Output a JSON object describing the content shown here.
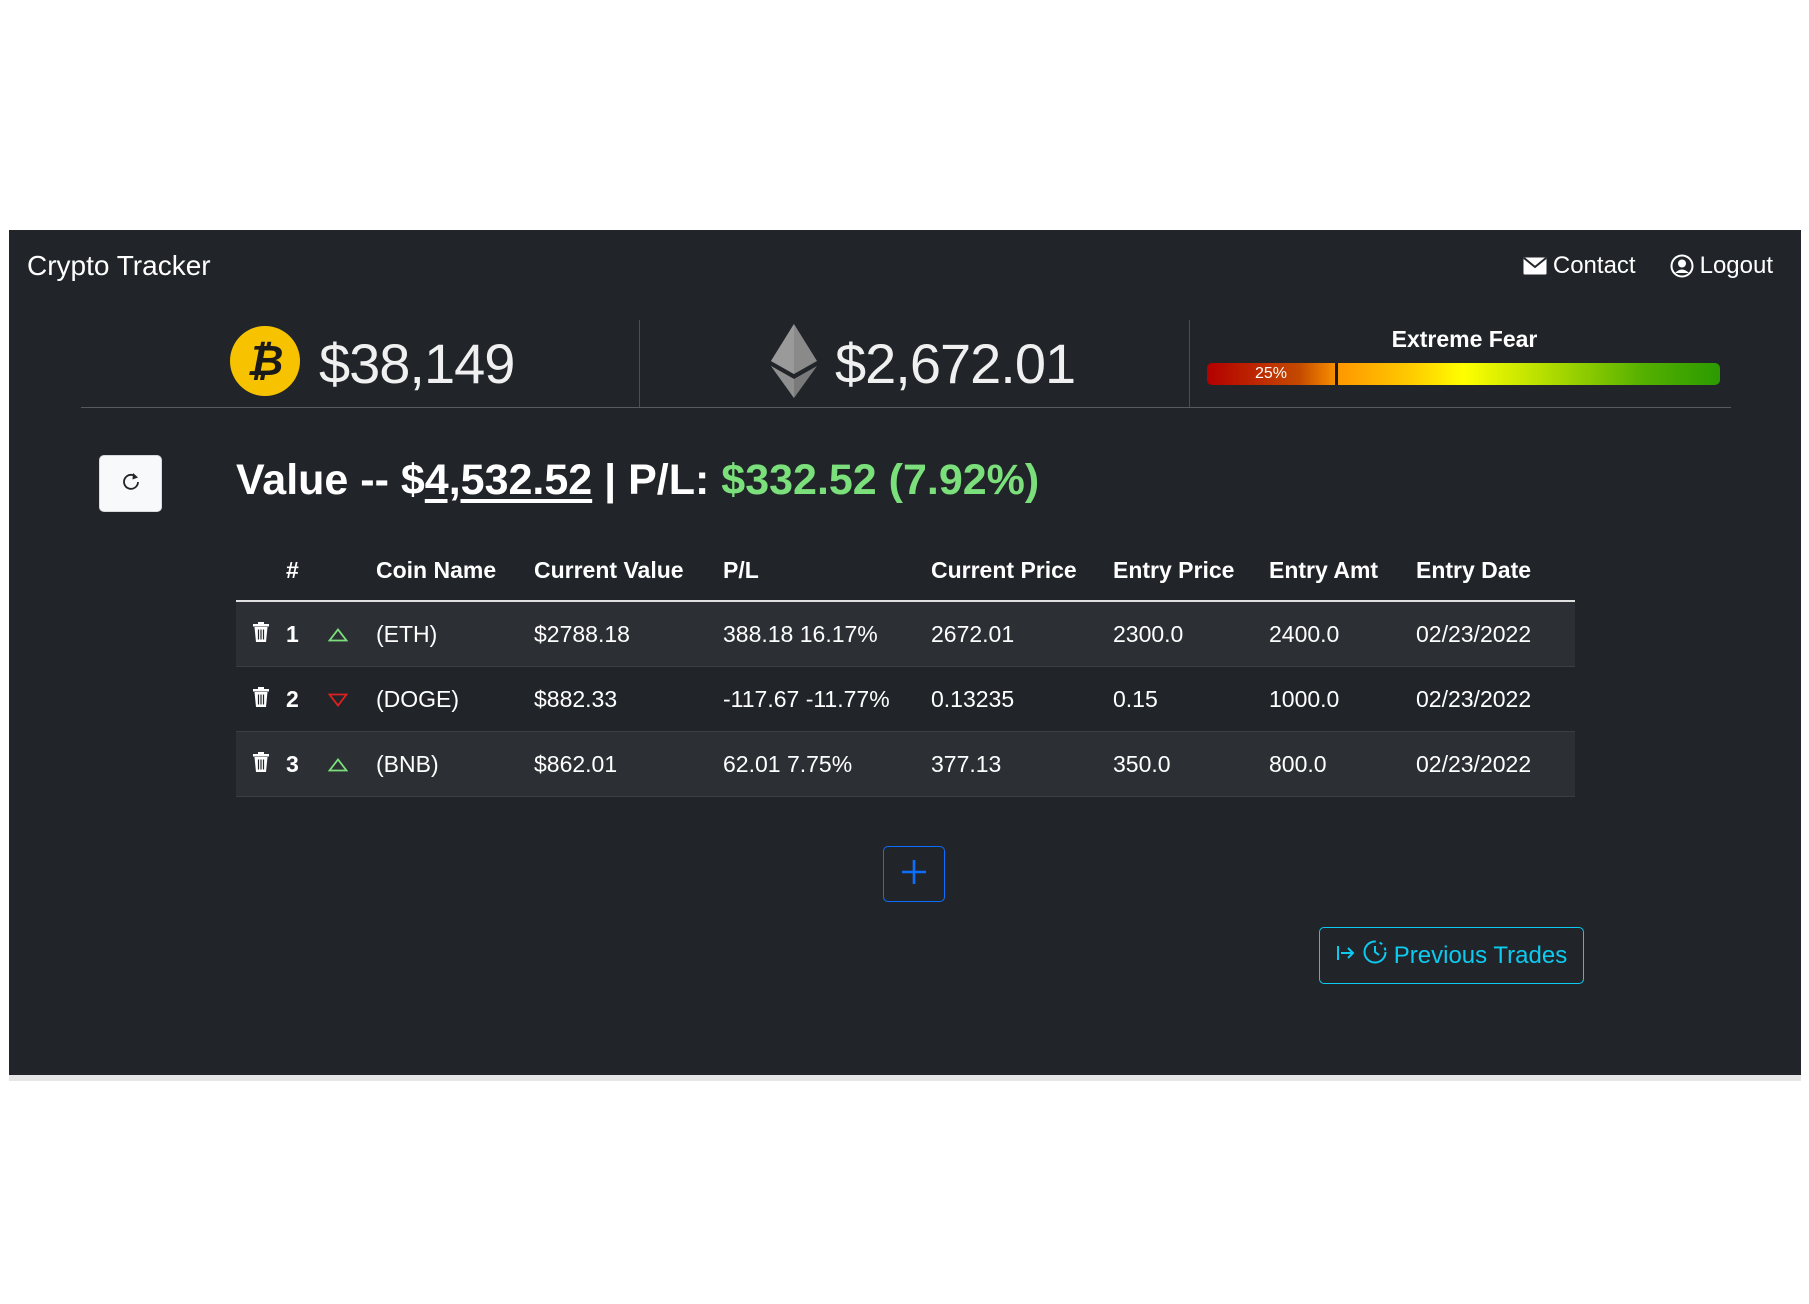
{
  "header": {
    "brand": "Crypto Tracker",
    "contact_label": "Contact",
    "logout_label": "Logout"
  },
  "tickers": {
    "btc_price": "$38,149",
    "eth_price": "$2,672.01"
  },
  "fear_greed": {
    "label": "Extreme Fear",
    "value_label": "25%",
    "value": 25
  },
  "summary": {
    "value_prefix": "Value -- $",
    "total": "4,532.52",
    "separator": " | P/L: ",
    "pl": "$332.52 (7.92%)"
  },
  "table": {
    "headers": [
      "",
      "#",
      "",
      "Coin Name",
      "Current Value",
      "P/L",
      "Current Price",
      "Entry Price",
      "Entry Amt",
      "Entry Date"
    ],
    "rows": [
      {
        "num": "1",
        "dir": "up",
        "coin": "(ETH)",
        "cval": "$2788.18",
        "pl": "388.18 16.17%",
        "cprice": "2672.01",
        "eprice": "2300.0",
        "eamt": "2400.0",
        "edate": "02/23/2022"
      },
      {
        "num": "2",
        "dir": "down",
        "coin": "(DOGE)",
        "cval": "$882.33",
        "pl": "-117.67 -11.77%",
        "cprice": "0.13235",
        "eprice": "0.15",
        "eamt": "1000.0",
        "edate": "02/23/2022"
      },
      {
        "num": "3",
        "dir": "up",
        "coin": "(BNB)",
        "cval": "$862.01",
        "pl": "62.01 7.75%",
        "cprice": "377.13",
        "eprice": "350.0",
        "eamt": "800.0",
        "edate": "02/23/2022"
      }
    ]
  },
  "actions": {
    "previous_trades_label": "Previous Trades"
  },
  "colors": {
    "background": "#212529",
    "profit": "#7be07b",
    "up_arrow": "#7be07b",
    "down_arrow": "#e02020",
    "primary": "#0d6efd",
    "info": "#0dcaf0",
    "btc": "#f7c300"
  },
  "icons": {
    "contact": "envelope-icon",
    "logout": "user-circle-icon",
    "btc": "bitcoin-icon",
    "eth": "ethereum-icon",
    "refresh": "refresh-icon",
    "delete": "trash-icon",
    "up": "triangle-up-icon",
    "down": "triangle-down-icon",
    "add": "plus-icon",
    "previous": "history-icon"
  }
}
